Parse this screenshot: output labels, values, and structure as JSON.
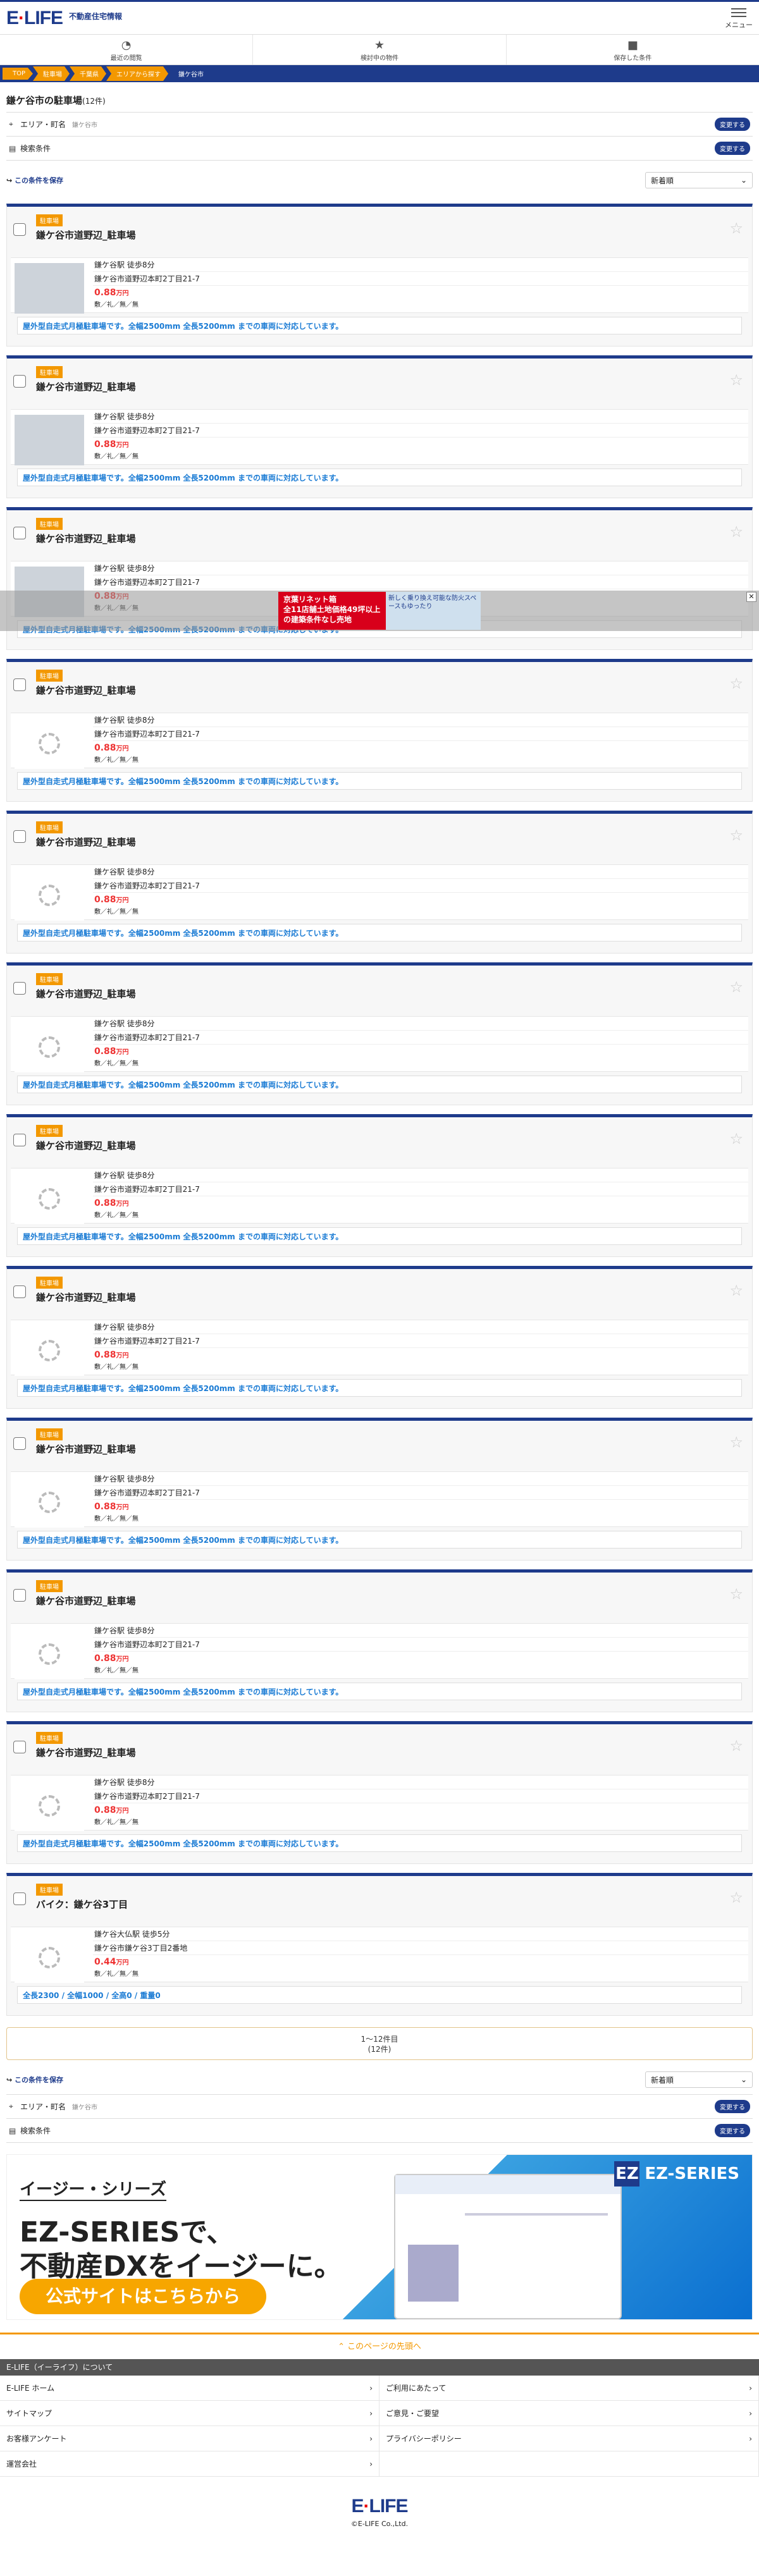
{
  "header": {
    "logo_text": "E-LIFE",
    "tagline": "不動産住宅情報",
    "menu_label": "メニュー"
  },
  "tabs": [
    {
      "label": "最近の閲覧",
      "icon": "clock-icon"
    },
    {
      "label": "検討中の物件",
      "icon": "star-icon"
    },
    {
      "label": "保存した条件",
      "icon": "folder-icon"
    }
  ],
  "breadcrumb": [
    "TOP",
    "駐車場",
    "千葉県",
    "エリアから探す",
    "鎌ケ谷市"
  ],
  "page": {
    "title": "鎌ケ谷市の駐車場",
    "count": "(12件)"
  },
  "conditions": {
    "area_label": "エリア・町名",
    "area_value": "鎌ケ谷市",
    "search_label": "検索条件",
    "change_label": "変更する",
    "save_label": "この条件を保存",
    "sort_value": "新着順"
  },
  "listings": [
    {
      "badge": "駐車場",
      "name": "鎌ケ谷市道野辺_駐車場",
      "station": "鎌ケ谷駅 徒歩8分",
      "address": "鎌ケ谷市道野辺本町2丁目21-7",
      "price": "0.88",
      "unit": "万円",
      "fees": "敷／礼／無／無",
      "note": "屋外型自走式月極駐車場です。全幅2500mm 全長5200mm までの車両に対応しています。"
    },
    {
      "badge": "駐車場",
      "name": "鎌ケ谷市道野辺_駐車場",
      "station": "鎌ケ谷駅 徒歩8分",
      "address": "鎌ケ谷市道野辺本町2丁目21-7",
      "price": "0.88",
      "unit": "万円",
      "fees": "敷／礼／無／無",
      "note": "屋外型自走式月極駐車場です。全幅2500mm 全長5200mm までの車両に対応しています。"
    },
    {
      "badge": "駐車場",
      "name": "鎌ケ谷市道野辺_駐車場",
      "station": "鎌ケ谷駅 徒歩8分",
      "address": "鎌ケ谷市道野辺本町2丁目21-7",
      "price": "0.88",
      "unit": "万円",
      "fees": "敷／礼／無／無",
      "note": "屋外型自走式月極駐車場です。全幅2500mm 全長5200mm までの車両に対応しています。"
    },
    {
      "badge": "駐車場",
      "name": "鎌ケ谷市道野辺_駐車場",
      "station": "鎌ケ谷駅 徒歩8分",
      "address": "鎌ケ谷市道野辺本町2丁目21-7",
      "price": "0.88",
      "unit": "万円",
      "fees": "敷／礼／無／無",
      "note": "屋外型自走式月極駐車場です。全幅2500mm 全長5200mm までの車両に対応しています。"
    },
    {
      "badge": "駐車場",
      "name": "鎌ケ谷市道野辺_駐車場",
      "station": "鎌ケ谷駅 徒歩8分",
      "address": "鎌ケ谷市道野辺本町2丁目21-7",
      "price": "0.88",
      "unit": "万円",
      "fees": "敷／礼／無／無",
      "note": "屋外型自走式月極駐車場です。全幅2500mm 全長5200mm までの車両に対応しています。"
    },
    {
      "badge": "駐車場",
      "name": "鎌ケ谷市道野辺_駐車場",
      "station": "鎌ケ谷駅 徒歩8分",
      "address": "鎌ケ谷市道野辺本町2丁目21-7",
      "price": "0.88",
      "unit": "万円",
      "fees": "敷／礼／無／無",
      "note": "屋外型自走式月極駐車場です。全幅2500mm 全長5200mm までの車両に対応しています。"
    },
    {
      "badge": "駐車場",
      "name": "鎌ケ谷市道野辺_駐車場",
      "station": "鎌ケ谷駅 徒歩8分",
      "address": "鎌ケ谷市道野辺本町2丁目21-7",
      "price": "0.88",
      "unit": "万円",
      "fees": "敷／礼／無／無",
      "note": "屋外型自走式月極駐車場です。全幅2500mm 全長5200mm までの車両に対応しています。"
    },
    {
      "badge": "駐車場",
      "name": "鎌ケ谷市道野辺_駐車場",
      "station": "鎌ケ谷駅 徒歩8分",
      "address": "鎌ケ谷市道野辺本町2丁目21-7",
      "price": "0.88",
      "unit": "万円",
      "fees": "敷／礼／無／無",
      "note": "屋外型自走式月極駐車場です。全幅2500mm 全長5200mm までの車両に対応しています。"
    },
    {
      "badge": "駐車場",
      "name": "鎌ケ谷市道野辺_駐車場",
      "station": "鎌ケ谷駅 徒歩8分",
      "address": "鎌ケ谷市道野辺本町2丁目21-7",
      "price": "0.88",
      "unit": "万円",
      "fees": "敷／礼／無／無",
      "note": "屋外型自走式月極駐車場です。全幅2500mm 全長5200mm までの車両に対応しています。"
    },
    {
      "badge": "駐車場",
      "name": "鎌ケ谷市道野辺_駐車場",
      "station": "鎌ケ谷駅 徒歩8分",
      "address": "鎌ケ谷市道野辺本町2丁目21-7",
      "price": "0.88",
      "unit": "万円",
      "fees": "敷／礼／無／無",
      "note": "屋外型自走式月極駐車場です。全幅2500mm 全長5200mm までの車両に対応しています。"
    },
    {
      "badge": "駐車場",
      "name": "鎌ケ谷市道野辺_駐車場",
      "station": "鎌ケ谷駅 徒歩8分",
      "address": "鎌ケ谷市道野辺本町2丁目21-7",
      "price": "0.88",
      "unit": "万円",
      "fees": "敷／礼／無／無",
      "note": "屋外型自走式月極駐車場です。全幅2500mm 全長5200mm までの車両に対応しています。"
    },
    {
      "badge": "駐車場",
      "name": "バイク：鎌ケ谷3丁目",
      "station": "鎌ケ谷大仏駅 徒歩5分",
      "address": "鎌ケ谷市鎌ケ谷3丁目2番地",
      "price": "0.44",
      "unit": "万円",
      "fees": "敷／礼／無／無",
      "note": "全長2300 / 全幅1000 / 全高0 / 重量0"
    }
  ],
  "pager": {
    "range": "1～12件目",
    "total": "(12件)"
  },
  "banner": {
    "line1": "イージー・シリーズ",
    "line2": "EZ-SERIESで、",
    "line3": "不動産DXをイージーに。",
    "cta": "公式サイトはこちらから",
    "logo": "EZ-SERIES"
  },
  "ad": {
    "title": "京葉リネット箱",
    "text": "全11店舗土地価格49坪以上の建築条件なし売地",
    "sub": "新しく乗り換え可能な防火スペースもゆったり"
  },
  "footer": {
    "top_link": "このページの先頭へ",
    "section": "E-LIFE（イーライフ）について",
    "links": [
      "E-LIFE ホーム",
      "ご利用にあたって",
      "サイトマップ",
      "ご意見・ご要望",
      "お客様アンケート",
      "プライバシーポリシー",
      "運営会社",
      ""
    ],
    "copyright": "©E-LIFE Co.,Ltd."
  }
}
